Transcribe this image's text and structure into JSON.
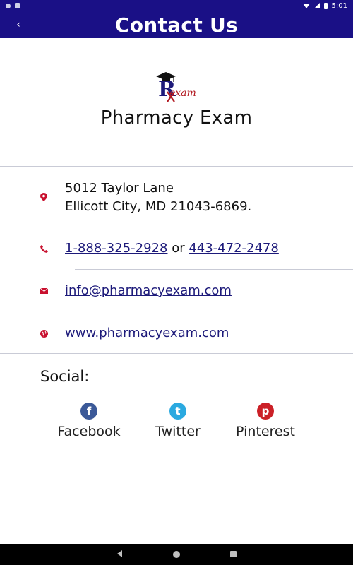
{
  "status_bar": {
    "time": "5:01",
    "icons": [
      "notification-dot-icon",
      "sdcard-icon",
      "wifi-icon",
      "signal-icon",
      "battery-icon"
    ]
  },
  "app_bar": {
    "title": "Contact Us",
    "back_icon": "‹",
    "background": "#1a1086"
  },
  "brand": {
    "logo_text": "exam",
    "name": "Pharmacy Exam"
  },
  "contact": {
    "address_line1": "5012 Taylor Lane",
    "address_line2": "Ellicott City, MD 21043-6869.",
    "phone1": "1-888-325-2928",
    "phone_separator": " or ",
    "phone2": "443-472-2478",
    "email": "info@pharmacyexam.com",
    "website": "www.pharmacyexam.com",
    "icon_color": "#c8102e",
    "link_color": "#1d1a7a"
  },
  "social": {
    "heading": "Social:",
    "items": [
      {
        "label": "Facebook",
        "icon": "facebook-icon",
        "glyph": "f",
        "color": "#3b5998"
      },
      {
        "label": "Twitter",
        "icon": "twitter-icon",
        "glyph": "t",
        "color": "#2aa9e0"
      },
      {
        "label": "Pinterest",
        "icon": "pinterest-icon",
        "glyph": "p",
        "color": "#cb2027"
      }
    ]
  }
}
